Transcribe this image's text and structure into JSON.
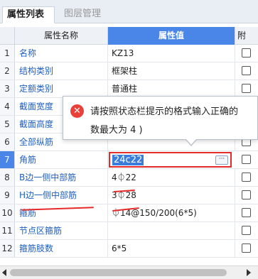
{
  "tabs": [
    {
      "label": "属性列表"
    },
    {
      "label": "图层管理"
    }
  ],
  "columns": {
    "name": "属性名称",
    "value": "属性值",
    "attach": "附"
  },
  "rows": [
    {
      "idx": "1",
      "name": "名称",
      "value": "KZ13"
    },
    {
      "idx": "2",
      "name": "结构类别",
      "value": "框架柱"
    },
    {
      "idx": "3",
      "name": "定额类别",
      "value": "普通柱"
    },
    {
      "idx": "4",
      "name": "截面宽度",
      "value": ""
    },
    {
      "idx": "5",
      "name": "截面高度",
      "value": ""
    },
    {
      "idx": "6",
      "name": "全部纵筋",
      "value": ""
    },
    {
      "idx": "7",
      "name": "角筋",
      "value": "24c22"
    },
    {
      "idx": "8",
      "name": "B边一侧中部筋",
      "value": "4⏀22"
    },
    {
      "idx": "9",
      "name": "H边一侧中部筋",
      "value": "3⏀28"
    },
    {
      "idx": "10",
      "name": "箍筋",
      "value": "⏀14@150/200(6*5)"
    },
    {
      "idx": "11",
      "name": "节点区箍筋",
      "value": ""
    },
    {
      "idx": "12",
      "name": "箍筋肢数",
      "value": "6*5"
    }
  ],
  "editor": {
    "value": "24c22",
    "more_label": "···"
  },
  "tooltip": {
    "line1": "请按照状态栏提示的格式输入正确的",
    "line2": "数最大为 4 )",
    "icon": "error-icon"
  },
  "colors": {
    "header_accent": "#4a86e8",
    "error": "#e52a2a",
    "link_text": "#1f5fbf"
  }
}
